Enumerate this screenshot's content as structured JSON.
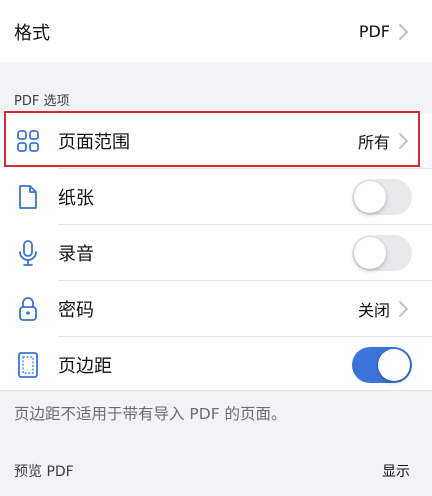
{
  "format": {
    "label": "格式",
    "value": "PDF"
  },
  "pdf_options": {
    "header": "PDF 选项",
    "rows": [
      {
        "label": "页面范围",
        "value": "所有",
        "icon": "grid-icon",
        "control": "disclosure"
      },
      {
        "label": "纸张",
        "icon": "document-icon",
        "control": "toggle",
        "on": false
      },
      {
        "label": "录音",
        "icon": "microphone-icon",
        "control": "toggle",
        "on": false
      },
      {
        "label": "密码",
        "value": "关闭",
        "icon": "lock-icon",
        "control": "disclosure"
      },
      {
        "label": "页边距",
        "icon": "margins-icon",
        "control": "toggle",
        "on": true
      }
    ],
    "footnote": "页边距不适用于带有导入 PDF 的页面。"
  },
  "preview": {
    "label": "预览 PDF",
    "action": "显示"
  },
  "colors": {
    "accent": "#3b73d9",
    "highlight_border": "#d9282f",
    "background": "#f2f2f7"
  }
}
